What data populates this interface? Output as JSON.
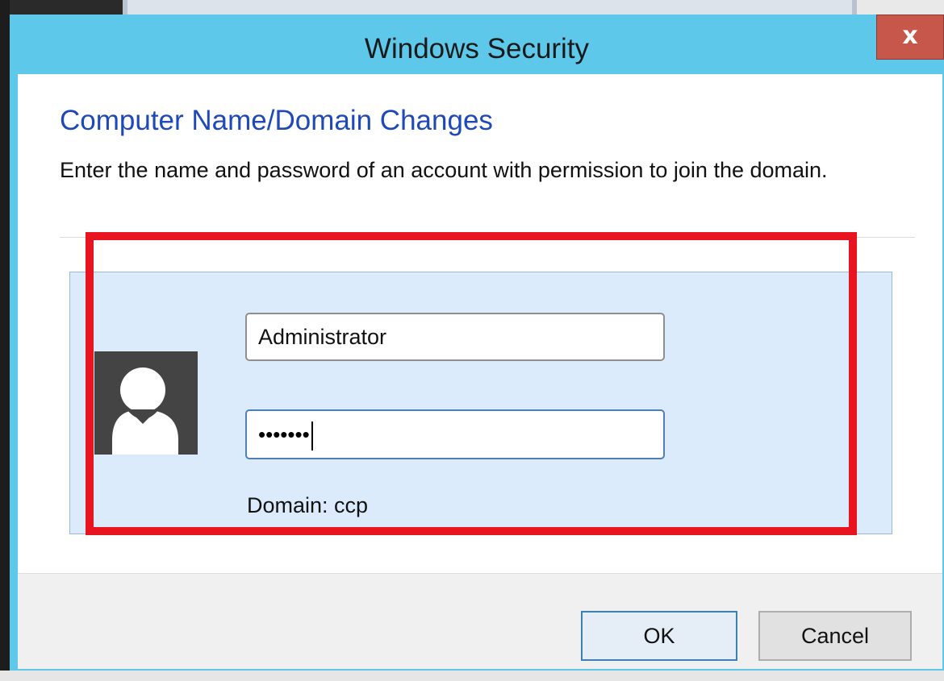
{
  "window": {
    "title": "Windows Security",
    "close_symbol": "x"
  },
  "content": {
    "heading": "Computer Name/Domain Changes",
    "instruction": "Enter the name and password of an account with permission to join the domain."
  },
  "credentials": {
    "username_value": "Administrator",
    "password_masked": "•••••••",
    "domain_label": "Domain: ccp",
    "avatar_icon": "user-avatar-icon"
  },
  "buttons": {
    "ok_label": "OK",
    "cancel_label": "Cancel"
  },
  "colors": {
    "titlebar": "#5ec8ea",
    "close_button": "#c7574b",
    "heading": "#1f48b8",
    "highlight": "#e8141f",
    "panel": "#dcebfc"
  }
}
